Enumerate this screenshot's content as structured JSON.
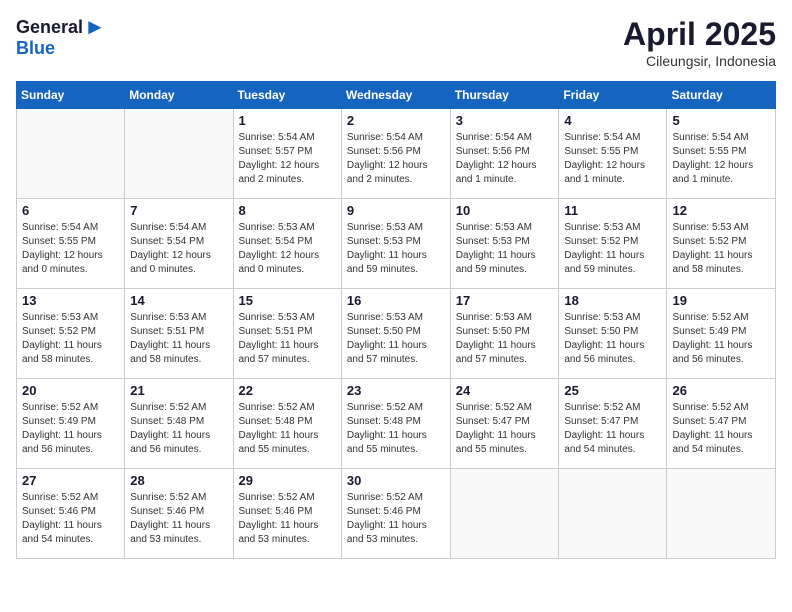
{
  "header": {
    "logo_general": "General",
    "logo_blue": "Blue",
    "title": "April 2025",
    "location": "Cileungsir, Indonesia"
  },
  "calendar": {
    "headers": [
      "Sunday",
      "Monday",
      "Tuesday",
      "Wednesday",
      "Thursday",
      "Friday",
      "Saturday"
    ],
    "weeks": [
      [
        {
          "day": "",
          "info": ""
        },
        {
          "day": "",
          "info": ""
        },
        {
          "day": "1",
          "info": "Sunrise: 5:54 AM\nSunset: 5:57 PM\nDaylight: 12 hours\nand 2 minutes."
        },
        {
          "day": "2",
          "info": "Sunrise: 5:54 AM\nSunset: 5:56 PM\nDaylight: 12 hours\nand 2 minutes."
        },
        {
          "day": "3",
          "info": "Sunrise: 5:54 AM\nSunset: 5:56 PM\nDaylight: 12 hours\nand 1 minute."
        },
        {
          "day": "4",
          "info": "Sunrise: 5:54 AM\nSunset: 5:55 PM\nDaylight: 12 hours\nand 1 minute."
        },
        {
          "day": "5",
          "info": "Sunrise: 5:54 AM\nSunset: 5:55 PM\nDaylight: 12 hours\nand 1 minute."
        }
      ],
      [
        {
          "day": "6",
          "info": "Sunrise: 5:54 AM\nSunset: 5:55 PM\nDaylight: 12 hours\nand 0 minutes."
        },
        {
          "day": "7",
          "info": "Sunrise: 5:54 AM\nSunset: 5:54 PM\nDaylight: 12 hours\nand 0 minutes."
        },
        {
          "day": "8",
          "info": "Sunrise: 5:53 AM\nSunset: 5:54 PM\nDaylight: 12 hours\nand 0 minutes."
        },
        {
          "day": "9",
          "info": "Sunrise: 5:53 AM\nSunset: 5:53 PM\nDaylight: 11 hours\nand 59 minutes."
        },
        {
          "day": "10",
          "info": "Sunrise: 5:53 AM\nSunset: 5:53 PM\nDaylight: 11 hours\nand 59 minutes."
        },
        {
          "day": "11",
          "info": "Sunrise: 5:53 AM\nSunset: 5:52 PM\nDaylight: 11 hours\nand 59 minutes."
        },
        {
          "day": "12",
          "info": "Sunrise: 5:53 AM\nSunset: 5:52 PM\nDaylight: 11 hours\nand 58 minutes."
        }
      ],
      [
        {
          "day": "13",
          "info": "Sunrise: 5:53 AM\nSunset: 5:52 PM\nDaylight: 11 hours\nand 58 minutes."
        },
        {
          "day": "14",
          "info": "Sunrise: 5:53 AM\nSunset: 5:51 PM\nDaylight: 11 hours\nand 58 minutes."
        },
        {
          "day": "15",
          "info": "Sunrise: 5:53 AM\nSunset: 5:51 PM\nDaylight: 11 hours\nand 57 minutes."
        },
        {
          "day": "16",
          "info": "Sunrise: 5:53 AM\nSunset: 5:50 PM\nDaylight: 11 hours\nand 57 minutes."
        },
        {
          "day": "17",
          "info": "Sunrise: 5:53 AM\nSunset: 5:50 PM\nDaylight: 11 hours\nand 57 minutes."
        },
        {
          "day": "18",
          "info": "Sunrise: 5:53 AM\nSunset: 5:50 PM\nDaylight: 11 hours\nand 56 minutes."
        },
        {
          "day": "19",
          "info": "Sunrise: 5:52 AM\nSunset: 5:49 PM\nDaylight: 11 hours\nand 56 minutes."
        }
      ],
      [
        {
          "day": "20",
          "info": "Sunrise: 5:52 AM\nSunset: 5:49 PM\nDaylight: 11 hours\nand 56 minutes."
        },
        {
          "day": "21",
          "info": "Sunrise: 5:52 AM\nSunset: 5:48 PM\nDaylight: 11 hours\nand 56 minutes."
        },
        {
          "day": "22",
          "info": "Sunrise: 5:52 AM\nSunset: 5:48 PM\nDaylight: 11 hours\nand 55 minutes."
        },
        {
          "day": "23",
          "info": "Sunrise: 5:52 AM\nSunset: 5:48 PM\nDaylight: 11 hours\nand 55 minutes."
        },
        {
          "day": "24",
          "info": "Sunrise: 5:52 AM\nSunset: 5:47 PM\nDaylight: 11 hours\nand 55 minutes."
        },
        {
          "day": "25",
          "info": "Sunrise: 5:52 AM\nSunset: 5:47 PM\nDaylight: 11 hours\nand 54 minutes."
        },
        {
          "day": "26",
          "info": "Sunrise: 5:52 AM\nSunset: 5:47 PM\nDaylight: 11 hours\nand 54 minutes."
        }
      ],
      [
        {
          "day": "27",
          "info": "Sunrise: 5:52 AM\nSunset: 5:46 PM\nDaylight: 11 hours\nand 54 minutes."
        },
        {
          "day": "28",
          "info": "Sunrise: 5:52 AM\nSunset: 5:46 PM\nDaylight: 11 hours\nand 53 minutes."
        },
        {
          "day": "29",
          "info": "Sunrise: 5:52 AM\nSunset: 5:46 PM\nDaylight: 11 hours\nand 53 minutes."
        },
        {
          "day": "30",
          "info": "Sunrise: 5:52 AM\nSunset: 5:46 PM\nDaylight: 11 hours\nand 53 minutes."
        },
        {
          "day": "",
          "info": ""
        },
        {
          "day": "",
          "info": ""
        },
        {
          "day": "",
          "info": ""
        }
      ]
    ]
  }
}
